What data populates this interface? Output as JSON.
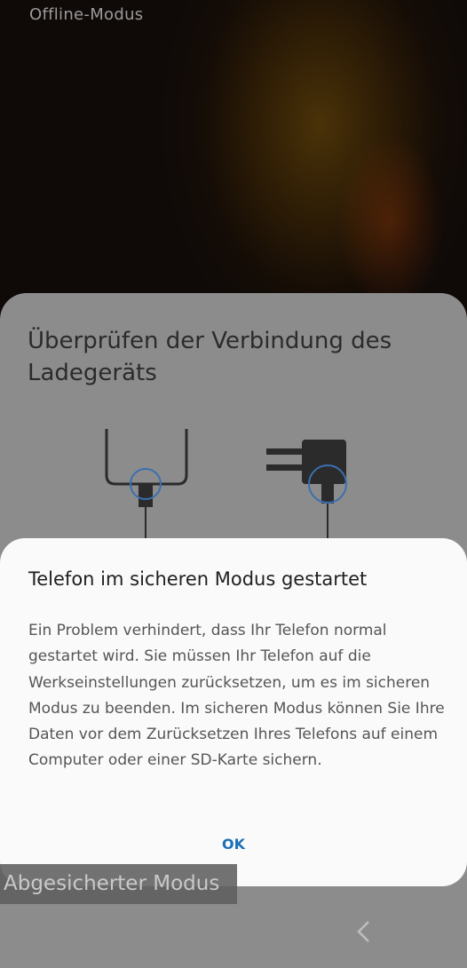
{
  "status_bar": {
    "mode_text": "Offline-Modus"
  },
  "background_sheet": {
    "title": "Überprüfen der Verbindung des Ladegeräts"
  },
  "dialog": {
    "title": "Telefon im sicheren Modus gestartet",
    "body": "Ein Problem verhindert, dass Ihr Telefon normal gestartet wird. Sie müssen Ihr Telefon auf die Werkseinstellungen zurücksetzen, um es im sicheren Modus zu beenden. Im sicheren Modus können Sie Ihre Daten vor dem Zurücksetzen Ihres Telefons auf einem Computer oder einer SD-Karte sichern.",
    "ok_label": "OK"
  },
  "watermark": {
    "safe_mode_label": "Abgesicherter Modus"
  },
  "navigation": {
    "back_icon": "chevron-left-icon"
  },
  "colors": {
    "accent": "#1b6fb7",
    "dialog_bg": "#fafafa",
    "dimmed_sheet": "#8c8c8c"
  }
}
